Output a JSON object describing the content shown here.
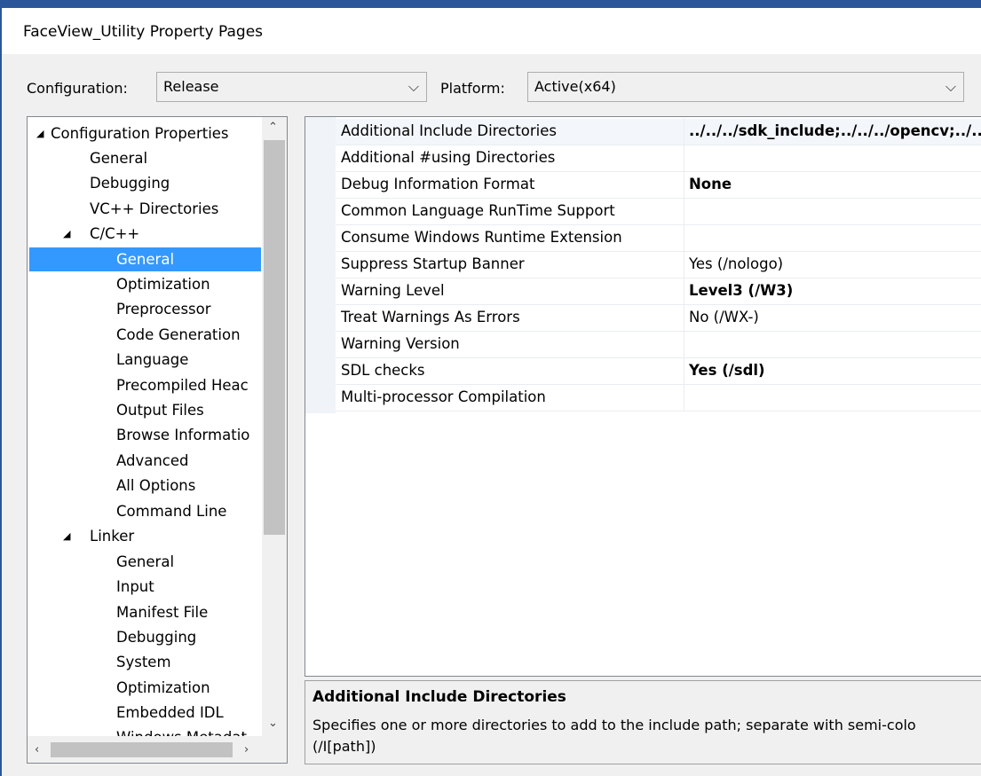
{
  "window": {
    "title": "FaceView_Utility Property Pages"
  },
  "toolbar": {
    "configuration_label": "Configuration:",
    "configuration_value": "Release",
    "platform_label": "Platform:",
    "platform_value": "Active(x64)"
  },
  "tree": {
    "items": [
      {
        "label": "Configuration Properties",
        "expander": "◢"
      },
      {
        "label": "General"
      },
      {
        "label": "Debugging"
      },
      {
        "label": "VC++ Directories"
      },
      {
        "label": "C/C++",
        "expander": "◢"
      },
      {
        "label": "General",
        "selected": true
      },
      {
        "label": "Optimization"
      },
      {
        "label": "Preprocessor"
      },
      {
        "label": "Code Generation"
      },
      {
        "label": "Language"
      },
      {
        "label": "Precompiled Heac"
      },
      {
        "label": "Output Files"
      },
      {
        "label": "Browse Informatio"
      },
      {
        "label": "Advanced"
      },
      {
        "label": "All Options"
      },
      {
        "label": "Command Line"
      },
      {
        "label": "Linker",
        "expander": "◢"
      },
      {
        "label": "General"
      },
      {
        "label": "Input"
      },
      {
        "label": "Manifest File"
      },
      {
        "label": "Debugging"
      },
      {
        "label": "System"
      },
      {
        "label": "Optimization"
      },
      {
        "label": "Embedded IDL"
      },
      {
        "label": "Windows Metadat"
      }
    ]
  },
  "properties": [
    {
      "name": "Additional Include Directories",
      "value": "../../../sdk_include;../../../opencv;../..",
      "bold": true
    },
    {
      "name": "Additional #using Directories",
      "value": ""
    },
    {
      "name": "Debug Information Format",
      "value": "None",
      "bold": true
    },
    {
      "name": "Common Language RunTime Support",
      "value": ""
    },
    {
      "name": "Consume Windows Runtime Extension",
      "value": ""
    },
    {
      "name": "Suppress Startup Banner",
      "value": "Yes (/nologo)"
    },
    {
      "name": "Warning Level",
      "value": "Level3 (/W3)",
      "bold": true
    },
    {
      "name": "Treat Warnings As Errors",
      "value": "No (/WX-)"
    },
    {
      "name": "Warning Version",
      "value": ""
    },
    {
      "name": "SDL checks",
      "value": "Yes (/sdl)",
      "bold": true
    },
    {
      "name": "Multi-processor Compilation",
      "value": ""
    }
  ],
  "description": {
    "title": "Additional Include Directories",
    "text": "Specifies one or more directories to add to the include path; separate with semi-colo (/I[path])"
  },
  "icons": {
    "combo_chevron": "chevron-down-icon",
    "tree_expander": "expanded-triangle-icon",
    "scroll_up": "scroll-up-arrow-icon",
    "scroll_down": "scroll-down-arrow-icon",
    "scroll_left": "scroll-left-arrow-icon",
    "scroll_right": "scroll-right-arrow-icon"
  },
  "colors": {
    "selection": "#3399ff",
    "window_border": "#2b579a",
    "background": "#f0f0f0"
  }
}
